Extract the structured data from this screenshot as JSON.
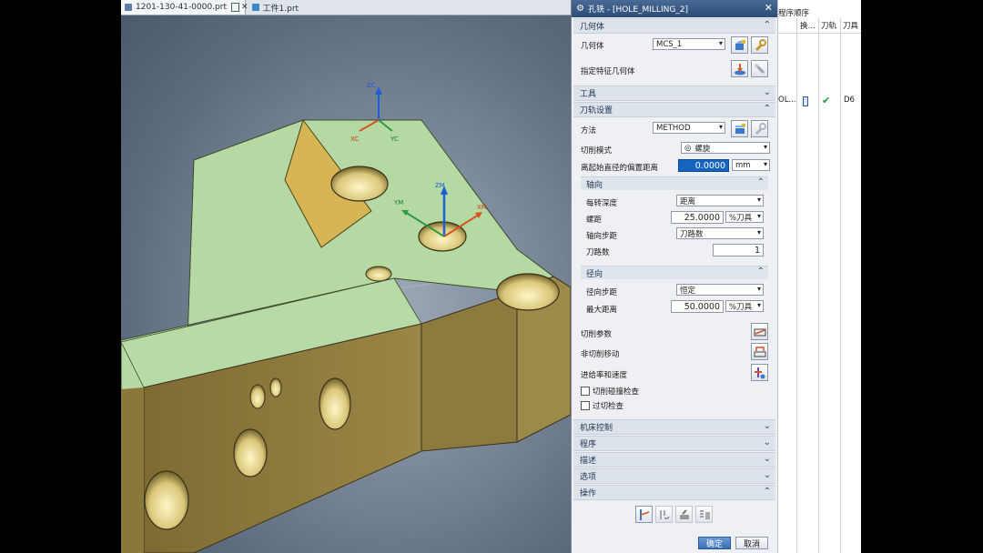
{
  "tabs": [
    {
      "label": "1201-130-41-0000.prt",
      "active": true
    },
    {
      "label": "工件1.prt",
      "active": false
    }
  ],
  "axes": {
    "zc": "ZC",
    "xc": "XC",
    "yc": "YC",
    "zm": "ZM",
    "xm": "XM",
    "ym": "YM"
  },
  "dialog": {
    "title": "孔铣 - [HOLE_MILLING_2]",
    "geometry": {
      "section": "几何体",
      "geometry_label": "几何体",
      "geometry_value": "MCS_1",
      "feature_label": "指定特征几何体"
    },
    "tool": {
      "section": "工具"
    },
    "path": {
      "section": "刀轨设置",
      "method_label": "方法",
      "method_value": "METHOD",
      "cut_mode_label": "切削模式",
      "cut_mode_value": "螺旋",
      "offset_label": "离起始直径的偏置距离",
      "offset_value": "0.0000",
      "offset_unit": "mm",
      "axial": {
        "section": "轴向",
        "depth_label": "每转深度",
        "depth_value": "距离",
        "pitch_label": "螺距",
        "pitch_value": "25.0000",
        "pitch_unit": "%刀具",
        "step_label": "轴向步距",
        "step_value": "刀路数",
        "passes_label": "刀路数",
        "passes_value": "1"
      },
      "radial": {
        "section": "径向",
        "step_label": "径向步距",
        "step_value": "恒定",
        "max_label": "最大距离",
        "max_value": "50.0000",
        "max_unit": "%刀具"
      },
      "cut_params_label": "切削参数",
      "noncut_label": "非切削移动",
      "feeds_label": "进给率和速度",
      "collision_label": "切削碰撞检查",
      "overcut_label": "过切检查"
    },
    "collapsed_sections": [
      "机床控制",
      "程序",
      "描述",
      "选项"
    ],
    "actions_section": "操作",
    "ok_label": "确定",
    "cancel_label": "取消"
  },
  "side_panel": {
    "title": "程序顺序",
    "headers": [
      "换...",
      "刀轨",
      "刀具"
    ],
    "row": {
      "name": "OL...",
      "tool": "D6"
    }
  },
  "colors": {
    "model_top": "#b4d9a4",
    "model_side": "#8c7a3e",
    "title_bar": "#3a5d89"
  }
}
